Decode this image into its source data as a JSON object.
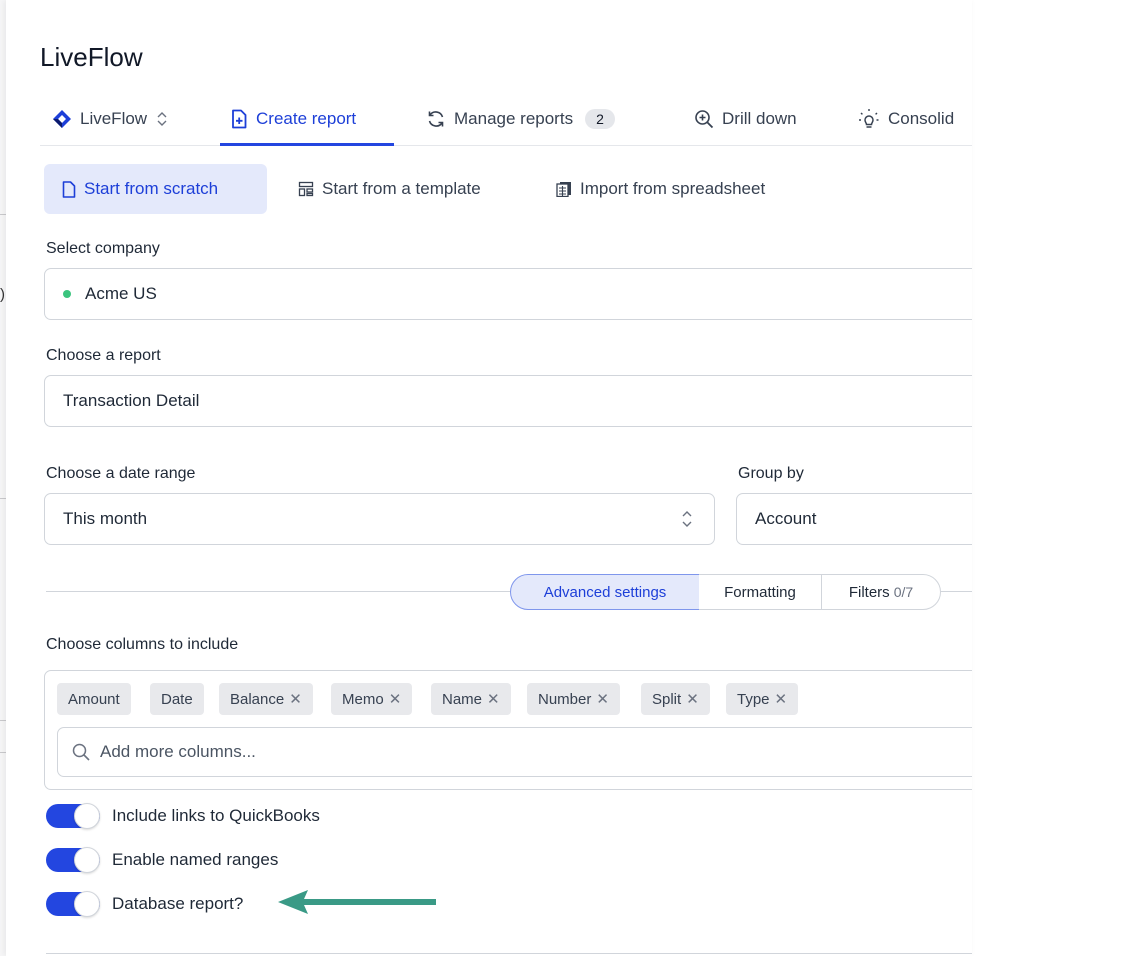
{
  "app": {
    "title": "LiveFlow"
  },
  "nav": {
    "items": [
      {
        "label": "LiveFlow",
        "icon": "liveflow-logo-icon"
      },
      {
        "label": "Create report",
        "icon": "plus-file-icon",
        "active": true
      },
      {
        "label": "Manage reports",
        "icon": "refresh-icon",
        "badge": "2"
      },
      {
        "label": "Drill down",
        "icon": "zoom-in-icon"
      },
      {
        "label": "Consolid",
        "icon": "lightbulb-icon"
      }
    ]
  },
  "subtabs": [
    {
      "label": "Start from scratch",
      "icon": "file-icon",
      "active": true
    },
    {
      "label": "Start from a template",
      "icon": "template-icon"
    },
    {
      "label": "Import from spreadsheet",
      "icon": "spreadsheet-icon"
    }
  ],
  "company": {
    "label": "Select company",
    "value": "Acme US",
    "status_color": "#3bc47e"
  },
  "report": {
    "label": "Choose a report",
    "value": "Transaction Detail"
  },
  "date_range": {
    "label": "Choose a date range",
    "value": "This month"
  },
  "group_by": {
    "label": "Group by",
    "value": "Account"
  },
  "settings_tabs": {
    "advanced": "Advanced settings",
    "formatting": "Formatting",
    "filters": "Filters",
    "filters_count": "0/7"
  },
  "columns": {
    "label": "Choose columns to include",
    "chips": [
      {
        "label": "Amount",
        "removable": false
      },
      {
        "label": "Date",
        "removable": false
      },
      {
        "label": "Balance",
        "removable": true
      },
      {
        "label": "Memo",
        "removable": true
      },
      {
        "label": "Name",
        "removable": true
      },
      {
        "label": "Number",
        "removable": true
      },
      {
        "label": "Split",
        "removable": true
      },
      {
        "label": "Type",
        "removable": true
      }
    ],
    "remove_glyph": "✕",
    "search_placeholder": "Add more columns..."
  },
  "toggles": [
    {
      "label": "Include links to QuickBooks",
      "on": true
    },
    {
      "label": "Enable named ranges",
      "on": true
    },
    {
      "label": "Database report?",
      "on": true
    }
  ],
  "colors": {
    "accent": "#2346e0",
    "accent_light": "#e4e9fb",
    "arrow": "#3a9a86"
  },
  "background_sheet": {
    "char": ")"
  }
}
